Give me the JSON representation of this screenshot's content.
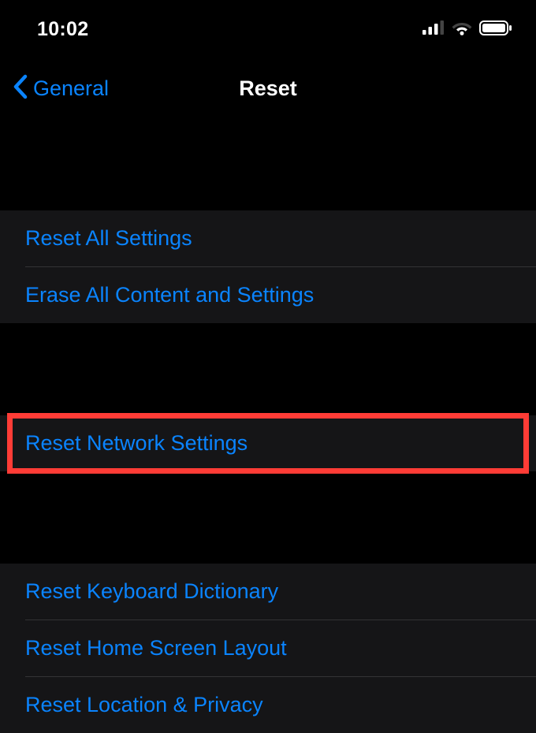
{
  "status_bar": {
    "time": "10:02"
  },
  "nav": {
    "back_label": "General",
    "title": "Reset"
  },
  "groups": [
    {
      "items": [
        {
          "label": "Reset All Settings",
          "highlighted": false
        },
        {
          "label": "Erase All Content and Settings",
          "highlighted": false
        }
      ]
    },
    {
      "items": [
        {
          "label": "Reset Network Settings",
          "highlighted": true
        }
      ]
    },
    {
      "items": [
        {
          "label": "Reset Keyboard Dictionary",
          "highlighted": false
        },
        {
          "label": "Reset Home Screen Layout",
          "highlighted": false
        },
        {
          "label": "Reset Location & Privacy",
          "highlighted": false
        }
      ]
    }
  ]
}
